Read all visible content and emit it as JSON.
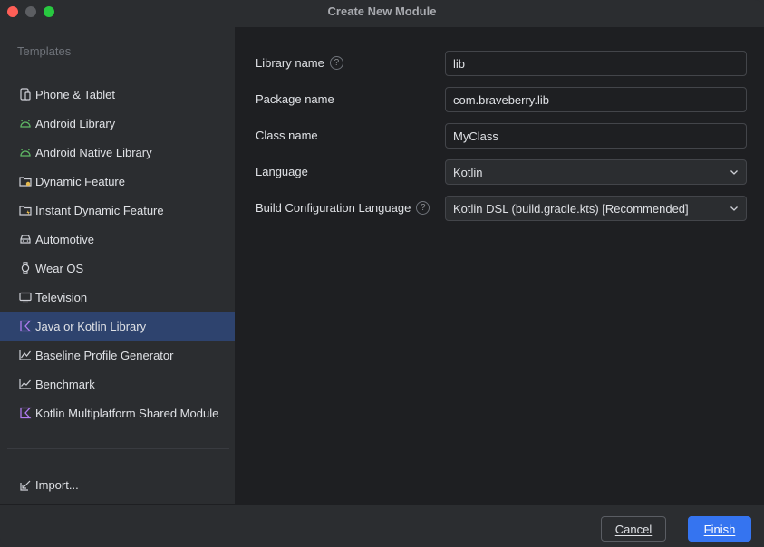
{
  "window": {
    "title": "Create New Module"
  },
  "sidebar": {
    "header": "Templates",
    "items": [
      {
        "label": "Phone & Tablet",
        "icon": "phone-tablet-icon",
        "selected": false
      },
      {
        "label": "Android Library",
        "icon": "android-icon",
        "selected": false
      },
      {
        "label": "Android Native Library",
        "icon": "android-icon",
        "selected": false
      },
      {
        "label": "Dynamic Feature",
        "icon": "dynamic-feature-icon",
        "selected": false
      },
      {
        "label": "Instant Dynamic Feature",
        "icon": "instant-dynamic-feature-icon",
        "selected": false
      },
      {
        "label": "Automotive",
        "icon": "car-icon",
        "selected": false
      },
      {
        "label": "Wear OS",
        "icon": "watch-icon",
        "selected": false
      },
      {
        "label": "Television",
        "icon": "tv-icon",
        "selected": false
      },
      {
        "label": "Java or Kotlin Library",
        "icon": "kotlin-icon",
        "selected": true
      },
      {
        "label": "Baseline Profile Generator",
        "icon": "baseline-profile-icon",
        "selected": false
      },
      {
        "label": "Benchmark",
        "icon": "benchmark-icon",
        "selected": false
      },
      {
        "label": "Kotlin Multiplatform Shared Module",
        "icon": "kotlin-icon",
        "selected": false
      }
    ],
    "import_label": "Import..."
  },
  "form": {
    "library_name": {
      "label": "Library name",
      "value": "lib",
      "has_help": true
    },
    "package_name": {
      "label": "Package name",
      "value": "com.braveberry.lib"
    },
    "class_name": {
      "label": "Class name",
      "value": "MyClass"
    },
    "language": {
      "label": "Language",
      "value": "Kotlin"
    },
    "build_config_language": {
      "label": "Build Configuration Language",
      "value": "Kotlin DSL (build.gradle.kts) [Recommended]",
      "has_help": true
    }
  },
  "footer": {
    "cancel_label": "Cancel",
    "finish_label": "Finish"
  },
  "colors": {
    "accent": "#3574f0",
    "selection": "#2e436e",
    "android_green": "#5fb865",
    "kotlin_purple": "#b07cf0"
  }
}
